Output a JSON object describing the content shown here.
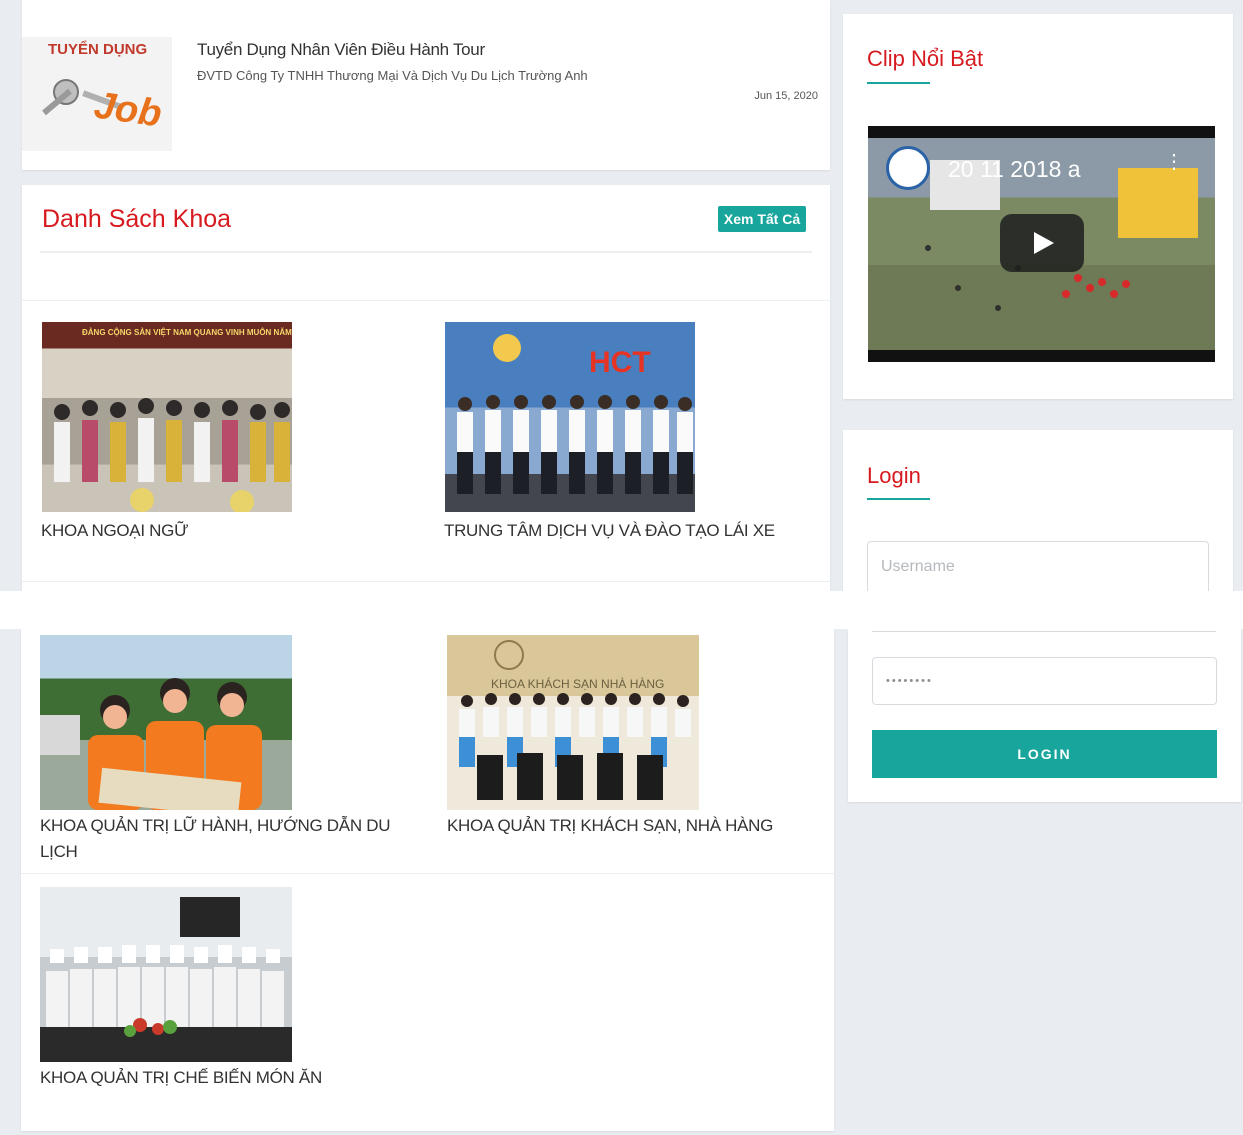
{
  "job_post": {
    "badge_top": "TUYỂN DỤNG",
    "badge_word": "Job",
    "title": "Tuyển Dụng Nhân Viên Điều Hành Tour",
    "company": "ĐVTD Công Ty TNHH Thương Mại Và Dịch Vụ Du Lịch Trường Anh",
    "date": "Jun 15, 2020"
  },
  "departments": {
    "heading": "Danh Sách Khoa",
    "view_all": "Xem Tất Cả",
    "items": [
      {
        "label": "KHOA NGOẠI NGỮ",
        "banner": "ĐẢNG CỘNG SẢN VIỆT NAM QUANG VINH MUÔN NĂM"
      },
      {
        "label": "TRUNG TÂM DỊCH VỤ VÀ ĐÀO TẠO LÁI XE",
        "banner": "HCT"
      },
      {
        "label": "KHOA QUẢN TRỊ LỮ HÀNH, HƯỚNG DẪN DU LỊCH"
      },
      {
        "label": "KHOA QUẢN TRỊ KHÁCH SẠN, NHÀ HÀNG",
        "banner": "KHOA KHÁCH SẠN NHÀ HÀNG"
      },
      {
        "label": "KHOA QUẢN TRỊ CHẾ BIẾN MÓN ĂN"
      }
    ]
  },
  "sidebar": {
    "clip": {
      "title": "Clip Nổi Bật",
      "video_title": "20 11 2018 a"
    },
    "login": {
      "title": "Login",
      "username_placeholder": "Username",
      "password_value": "••••••••",
      "button": "LOGIN"
    }
  },
  "colors": {
    "accent": "#17a59c",
    "heading_red": "#d61a1f",
    "background": "#e9edf1"
  }
}
